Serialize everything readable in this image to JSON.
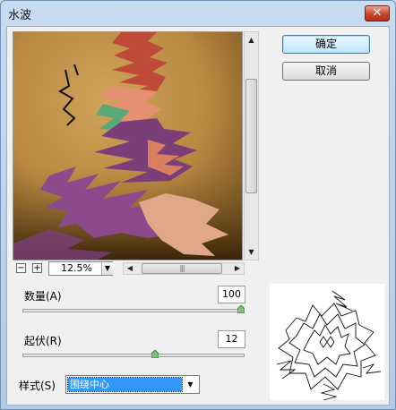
{
  "window": {
    "title": "水波",
    "close_glyph": "✕"
  },
  "buttons": {
    "ok": "确定",
    "cancel": "取消"
  },
  "zoom": {
    "value": "12.5%",
    "minus": "−",
    "plus": "+"
  },
  "scroll": {
    "grip": "|||"
  },
  "amount": {
    "label": "数量(A)",
    "value": "100",
    "percent": 100
  },
  "ridges": {
    "label": "起伏(R)",
    "value": "12",
    "percent": 60
  },
  "style": {
    "label": "样式(S)",
    "selected": "围绕中心"
  }
}
